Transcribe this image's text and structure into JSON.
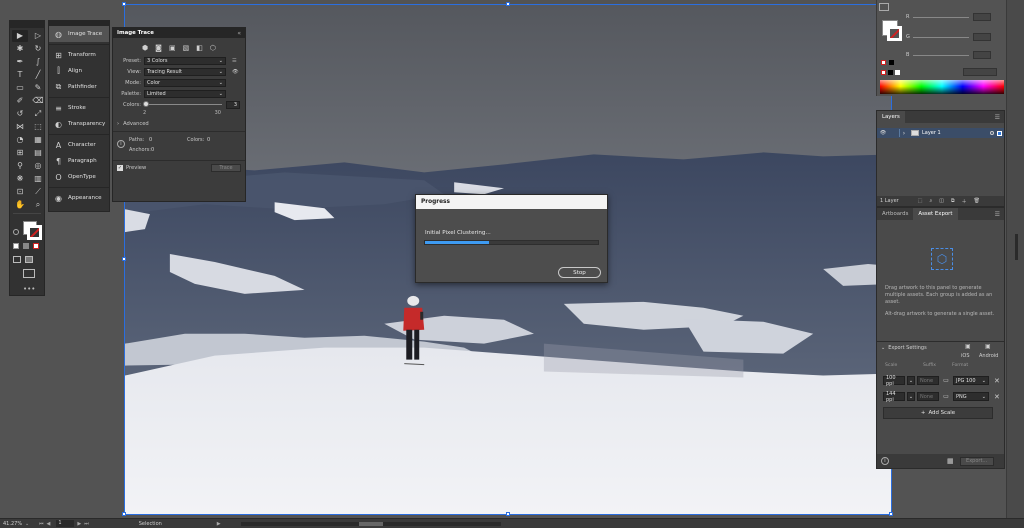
{
  "toolbar": {
    "colors": {
      "fill": "#ffffff",
      "stroke": "#d02020"
    }
  },
  "dock": {
    "items": [
      {
        "label": "Image Trace",
        "icon": "image-trace-icon"
      },
      {
        "label": "Transform",
        "icon": "transform-icon"
      },
      {
        "label": "Align",
        "icon": "align-icon"
      },
      {
        "label": "Pathfinder",
        "icon": "pathfinder-icon"
      },
      {
        "label": "Stroke",
        "icon": "stroke-icon"
      },
      {
        "label": "Transparency",
        "icon": "transparency-icon"
      },
      {
        "label": "Character",
        "icon": "character-icon"
      },
      {
        "label": "Paragraph",
        "icon": "paragraph-icon"
      },
      {
        "label": "OpenType",
        "icon": "opentype-icon"
      },
      {
        "label": "Appearance",
        "icon": "appearance-icon"
      }
    ]
  },
  "image_trace": {
    "tab": "Image Trace",
    "preset_label": "Preset:",
    "preset_value": "3 Colors",
    "view_label": "View:",
    "view_value": "Tracing Result",
    "mode_label": "Mode:",
    "mode_value": "Color",
    "palette_label": "Palette:",
    "palette_value": "Limited",
    "colors_label": "Colors:",
    "colors_value": "3",
    "slider_min": "2",
    "slider_max": "30",
    "advanced_label": "Advanced",
    "paths_label": "Paths:",
    "paths_value": "0",
    "colors_count_label": "Colors:",
    "colors_count_value": "0",
    "anchors_label": "Anchors:",
    "anchors_value": "0",
    "preview_label": "Preview",
    "trace_button": "Trace"
  },
  "progress_dialog": {
    "title": "Progress",
    "status": "Initial Pixel Clustering...",
    "progress": 0.37,
    "stop_label": "Stop"
  },
  "color_panel": {
    "r_label": "R",
    "g_label": "G",
    "b_label": "B"
  },
  "layers_panel": {
    "tab": "Layers",
    "layer_name": "Layer 1",
    "footer_count": "1 Layer"
  },
  "asset_export": {
    "tab_artboards": "Artboards",
    "tab_asset_export": "Asset Export",
    "drag_hint": "Drag artwork to this panel to generate multiple assets. Each group is added as an asset.",
    "alt_hint": "Alt-drag artwork to generate a single asset.",
    "export_settings_label": "Export Settings",
    "ios_label": "iOS",
    "android_label": "Android",
    "col_scale": "Scale",
    "col_suffix": "Suffix",
    "col_format": "Format",
    "rows": [
      {
        "scale": "100 ppi",
        "suffix": "None",
        "format": "JPG 100"
      },
      {
        "scale": "144 ppi",
        "suffix": "None",
        "format": "PNG"
      }
    ],
    "add_scale_label": "Add Scale",
    "export_button": "Export..."
  },
  "status_bar": {
    "zoom": "41.27%",
    "artboard_number": "1",
    "tool_name": "Selection"
  }
}
